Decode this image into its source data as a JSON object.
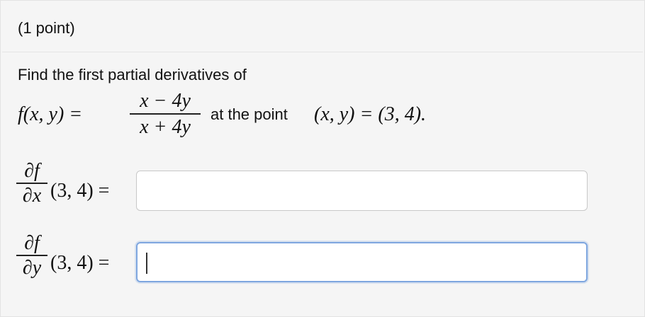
{
  "problem": {
    "points_label": "(1 point)",
    "prompt": "Find the first partial derivatives of",
    "function_lhs": "f(x, y) =",
    "numerator": "x − 4y",
    "denominator": "x + 4y",
    "at_text": "at the point",
    "point_expr": "(x, y) = (3, 4)."
  },
  "answers": [
    {
      "deriv_num": "∂f",
      "deriv_den": "∂x",
      "eval_text": "(3, 4) =",
      "value": "",
      "focused": false
    },
    {
      "deriv_num": "∂f",
      "deriv_den": "∂y",
      "eval_text": "(3, 4) =",
      "value": "",
      "focused": true
    }
  ]
}
